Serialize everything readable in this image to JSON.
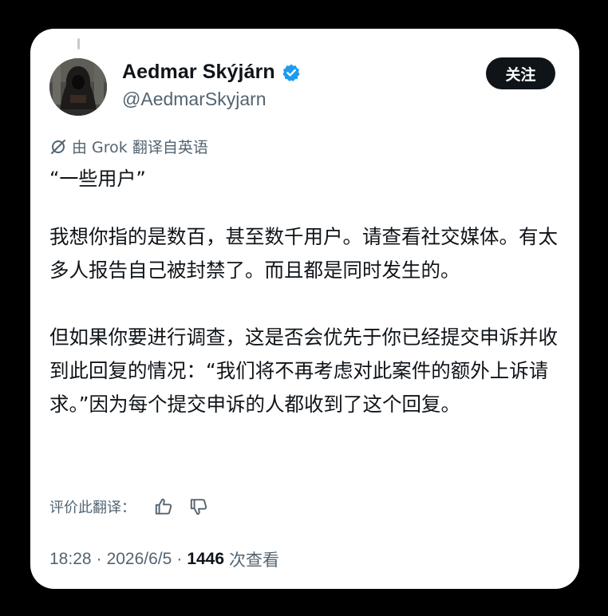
{
  "author": {
    "display_name": "Aedmar Skýjárn",
    "handle": "@AedmarSkyjarn",
    "verified_icon": "verified-badge-icon",
    "accent": "#1d9bf0"
  },
  "follow_button": {
    "label": "关注"
  },
  "translation_note": {
    "icon": "translate-icon",
    "text": "由 Grok 翻译自英语"
  },
  "tweet": {
    "quote_line": "“一些用户”",
    "paragraphs": [
      "我想你指的是数百，甚至数千用户。请查看社交媒体。有太多人报告自己被封禁了。而且都是同时发生的。",
      "但如果你要进行调查，这是否会优先于你已经提交申诉并收到此回复的情况：“我们将不再考虑对此案件的额外上诉请求。”因为每个提交申诉的人都收到了这个回复。"
    ]
  },
  "rate_translation": {
    "label": "评价此翻译：",
    "thumbs_up_icon": "thumbs-up-icon",
    "thumbs_down_icon": "thumbs-down-icon"
  },
  "meta": {
    "time": "18:28",
    "date": "2026/6/5",
    "separator": "·",
    "views_count": "1446",
    "views_label": "次查看"
  }
}
